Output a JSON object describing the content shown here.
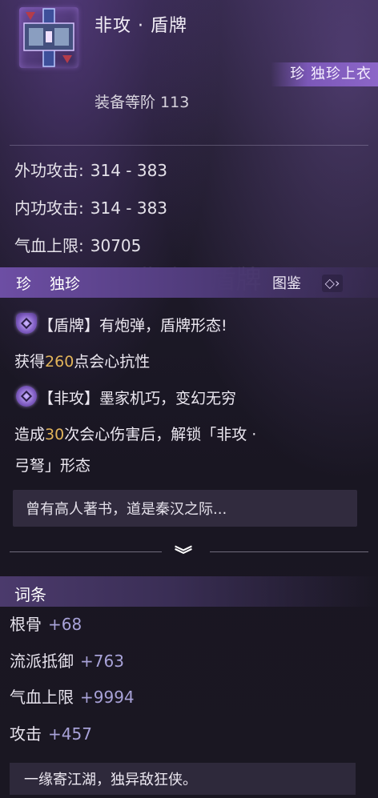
{
  "item": {
    "title": "非攻 · 盾牌",
    "rarity_label": "珍 独珍上衣",
    "rank_text": "装备等阶 113"
  },
  "stats": [
    {
      "label": "外功攻击:",
      "value": "314 - 383"
    },
    {
      "label": "内功攻击:",
      "value": "314 - 383"
    },
    {
      "label": "气血上限:",
      "value": "30705"
    }
  ],
  "rarity_bar": {
    "gem": "珍",
    "name": "独珍",
    "codex_label": "图鉴",
    "arrow": "◇›"
  },
  "effects": {
    "effect1_title": "【盾牌】有炮弹，盾牌形态!",
    "effect1_pre": "获得",
    "effect1_num": "260",
    "effect1_post": "点会心抗性",
    "effect2_title": "【非攻】墨家机巧，变幻无穷",
    "effect2_pre": "造成",
    "effect2_num": "30",
    "effect2_post": "次会心伤害后，解锁「非攻 ·",
    "effect2_line2": "弓弩」形态"
  },
  "lore": "曾有高人著书，道是秦汉之际...",
  "expand_icon": "︾",
  "affix": {
    "title": "词条",
    "items": [
      {
        "label": "根骨",
        "value": "+68"
      },
      {
        "label": "流派抵御",
        "value": "+763"
      },
      {
        "label": "气血上限",
        "value": "+9994"
      },
      {
        "label": "攻击",
        "value": "+457"
      }
    ]
  },
  "footer": "一缘寄江湖，独异敌狂侠。",
  "colors": {
    "accent": "#7c58b8",
    "gold": "#e2b45a",
    "affix_value": "#a8a2d8"
  }
}
